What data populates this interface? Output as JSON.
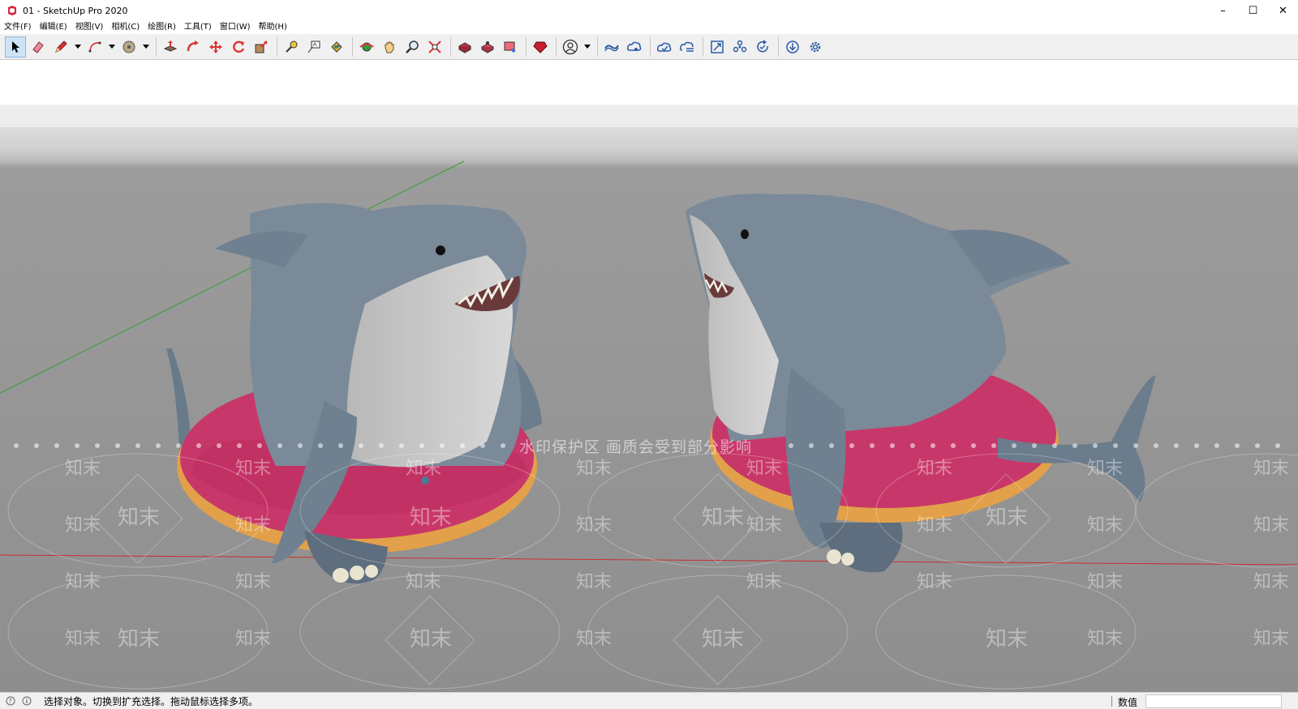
{
  "window": {
    "title": "01 - SketchUp Pro 2020",
    "minimize": "–",
    "maximize": "☐",
    "close": "✕"
  },
  "menu": [
    {
      "label": "文件(F)"
    },
    {
      "label": "编辑(E)"
    },
    {
      "label": "视图(V)"
    },
    {
      "label": "相机(C)"
    },
    {
      "label": "绘图(R)"
    },
    {
      "label": "工具(T)"
    },
    {
      "label": "窗口(W)"
    },
    {
      "label": "帮助(H)"
    }
  ],
  "toolbar_icons": [
    "select-icon",
    "eraser-icon",
    "pencil-icon",
    "arc-icon",
    "circle-icon",
    "push-pull-icon",
    "follow-me-icon",
    "move-icon",
    "rotate-icon",
    "scale-icon",
    "tape-measure-icon",
    "text-icon",
    "paint-bucket-icon",
    "orbit-icon",
    "pan-icon",
    "zoom-icon",
    "zoom-extents-icon",
    "warehouse-icon",
    "extension-warehouse-icon",
    "layout-icon",
    "ruby-icon",
    "profile-icon",
    "trimble-connect-icon",
    "share-icon",
    "cloud-upload-icon",
    "cloud-sync-icon",
    "scenes-icon",
    "components-icon",
    "refresh-icon",
    "download-icon",
    "settings-icon"
  ],
  "watermark": {
    "notice": "水印保护区   画质会受到部分影响",
    "brand": "知末"
  },
  "status": {
    "text": "选择对象。切换到扩充选择。拖动鼠标选择多项。",
    "measure_label": "数值"
  },
  "colors": {
    "shark_body": "#7a8a98",
    "shark_belly": "#c4c4c4",
    "ring_pink": "#c8376a",
    "ring_dough": "#e2a04a",
    "ground": "#8f8f8f"
  }
}
